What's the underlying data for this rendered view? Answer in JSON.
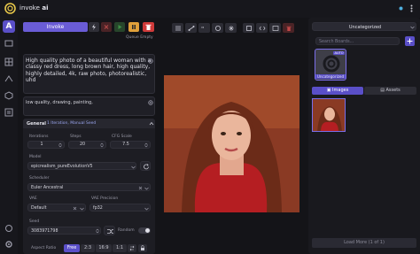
{
  "app": {
    "brand_a": "invoke",
    "brand_b": " ai"
  },
  "colors": {
    "accent": "#5a4fc8",
    "invoke": "#6a5cd6",
    "danger": "#d03a3a",
    "play": "#3e8f46",
    "pause": "#e0a03a"
  },
  "toolbar": {
    "invoke_label": "Invoke",
    "queue_status": "Queue Empty"
  },
  "prompt": {
    "positive": "High quality photo of a beautiful woman with a classy red dress, long brown hair, high quality, highly detailed, 4k, raw photo, photorealistic, uhd",
    "negative": "low quality, drawing, painting,"
  },
  "general": {
    "title": "General",
    "subtitle": "1 Iteration, Manual Seed",
    "iterations_label": "Iterations",
    "iterations_value": "1",
    "steps_label": "Steps",
    "steps_value": "20",
    "cfg_label": "CFG Scale",
    "cfg_value": "7.5",
    "model_label": "Model",
    "model_value": "epicrealism_pureEvolutionV5",
    "scheduler_label": "Scheduler",
    "scheduler_value": "Euler Ancestral",
    "vae_label": "VAE",
    "vae_value": "Default",
    "vae_precision_label": "VAE Precision",
    "vae_precision_value": "fp32",
    "seed_label": "Seed",
    "seed_value": "3083971798",
    "random_label": "Random",
    "aspect_label": "Aspect Ratio",
    "aspect_options": [
      "Free",
      "2:3",
      "16:9",
      "1:1"
    ]
  },
  "gallery": {
    "board_select": "Uncategorized",
    "search_placeholder": "Search Boards...",
    "board_name": "Uncategorized",
    "auto_badge": "AUTO",
    "tab_images": "Images",
    "tab_assets": "Assets",
    "load_more": "Load More (1 of 1)"
  }
}
